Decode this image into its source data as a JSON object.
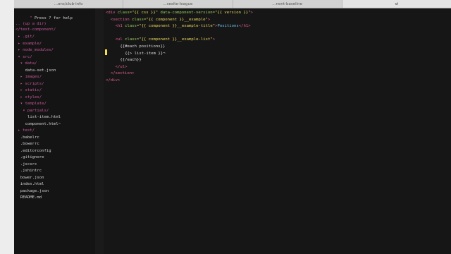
{
  "tabs": [
    "...ons/club-info",
    "...sesite-league",
    "...nent-baseline",
    "vi"
  ],
  "tree": {
    "help": "Press ? for help",
    "up": ".. (up a dir)",
    "root": "</test-component/",
    "items": [
      {
        "label": "▸ .git/",
        "depth": 1,
        "color": "#c7579a"
      },
      {
        "label": "▸ example/",
        "depth": 1,
        "color": "#c7579a"
      },
      {
        "label": "▸ node_modules/",
        "depth": 1,
        "color": "#c7579a"
      },
      {
        "label": "▾ src/",
        "depth": 1,
        "color": "#c7579a"
      },
      {
        "label": "▾ data/",
        "depth": 2,
        "color": "#c7579a"
      },
      {
        "label": "data-set.json",
        "depth": 4,
        "color": "#d0d0d0"
      },
      {
        "label": "▸ images/",
        "depth": 2,
        "color": "#c7579a"
      },
      {
        "label": "▸ scripts/",
        "depth": 2,
        "color": "#c7579a"
      },
      {
        "label": "▸ static/",
        "depth": 2,
        "color": "#c7579a"
      },
      {
        "label": "▸ styles/",
        "depth": 2,
        "color": "#c7579a"
      },
      {
        "label": "▾ template/",
        "depth": 2,
        "color": "#c7579a"
      },
      {
        "label": "▾ partials/",
        "depth": 3,
        "color": "#c7579a"
      },
      {
        "label": "list-item.html",
        "depth": 5,
        "color": "#d0d0d0"
      },
      {
        "label": "component.html~",
        "depth": 4,
        "color": "#d0d0d0"
      },
      {
        "label": "▸ test/",
        "depth": 1,
        "color": "#c7579a"
      },
      {
        "label": ".babelrc",
        "depth": 2,
        "color": "#d0d0d0"
      },
      {
        "label": ".bowerrc",
        "depth": 2,
        "color": "#d0d0d0"
      },
      {
        "label": ".editorconfig",
        "depth": 2,
        "color": "#d0d0d0"
      },
      {
        "label": ".gitignore",
        "depth": 2,
        "color": "#d0d0d0"
      },
      {
        "label": ".jscsrc",
        "depth": 2,
        "color": "#d0d0d0"
      },
      {
        "label": ".jshintrc",
        "depth": 2,
        "color": "#d0d0d0"
      },
      {
        "label": "bower.json",
        "depth": 2,
        "color": "#d0d0d0"
      },
      {
        "label": "index.html",
        "depth": 2,
        "color": "#d0d0d0"
      },
      {
        "label": "package.json",
        "depth": 2,
        "color": "#d0d0d0"
      },
      {
        "label": "README.md",
        "depth": 2,
        "color": "#d0d0d0"
      }
    ]
  },
  "code": [
    {
      "indent": 0,
      "tokens": [
        [
          "tag",
          "<div "
        ],
        [
          "attr",
          "class="
        ],
        [
          "str",
          "\"{{ css }}\" "
        ],
        [
          "attr",
          "data-component-version="
        ],
        [
          "str",
          "\"{{ version }}\""
        ],
        [
          "tag",
          ">"
        ]
      ]
    },
    {
      "indent": 2,
      "tokens": [
        [
          "tag",
          "<section "
        ],
        [
          "attr",
          "class="
        ],
        [
          "str",
          "\"{{ component }}__example\""
        ],
        [
          "tag",
          ">"
        ]
      ]
    },
    {
      "indent": 4,
      "tokens": [
        [
          "tag",
          "<h1 "
        ],
        [
          "attr",
          "class="
        ],
        [
          "str",
          "\"{{ component }}__example-title\""
        ],
        [
          "tag",
          ">"
        ],
        [
          "hl",
          "Positions"
        ],
        [
          "tag",
          "</h1>"
        ]
      ]
    },
    {
      "indent": 0,
      "tokens": []
    },
    {
      "indent": 4,
      "tokens": [
        [
          "tag",
          "<ul "
        ],
        [
          "attr",
          "class="
        ],
        [
          "str",
          "\"{{ component }}__example-list\""
        ],
        [
          "tag",
          ">"
        ]
      ]
    },
    {
      "indent": 6,
      "tokens": [
        [
          "plain",
          "{{#each positions}}"
        ]
      ]
    },
    {
      "indent": 8,
      "tokens": [
        [
          "plain",
          "{{> list-item }}¬"
        ]
      ]
    },
    {
      "indent": 6,
      "tokens": [
        [
          "plain",
          "{{/each}}"
        ]
      ]
    },
    {
      "indent": 4,
      "tokens": [
        [
          "tag",
          "</ul>"
        ]
      ]
    },
    {
      "indent": 2,
      "tokens": [
        [
          "tag",
          "</section>"
        ]
      ]
    },
    {
      "indent": 0,
      "tokens": [
        [
          "tag",
          "</div>"
        ]
      ]
    }
  ]
}
